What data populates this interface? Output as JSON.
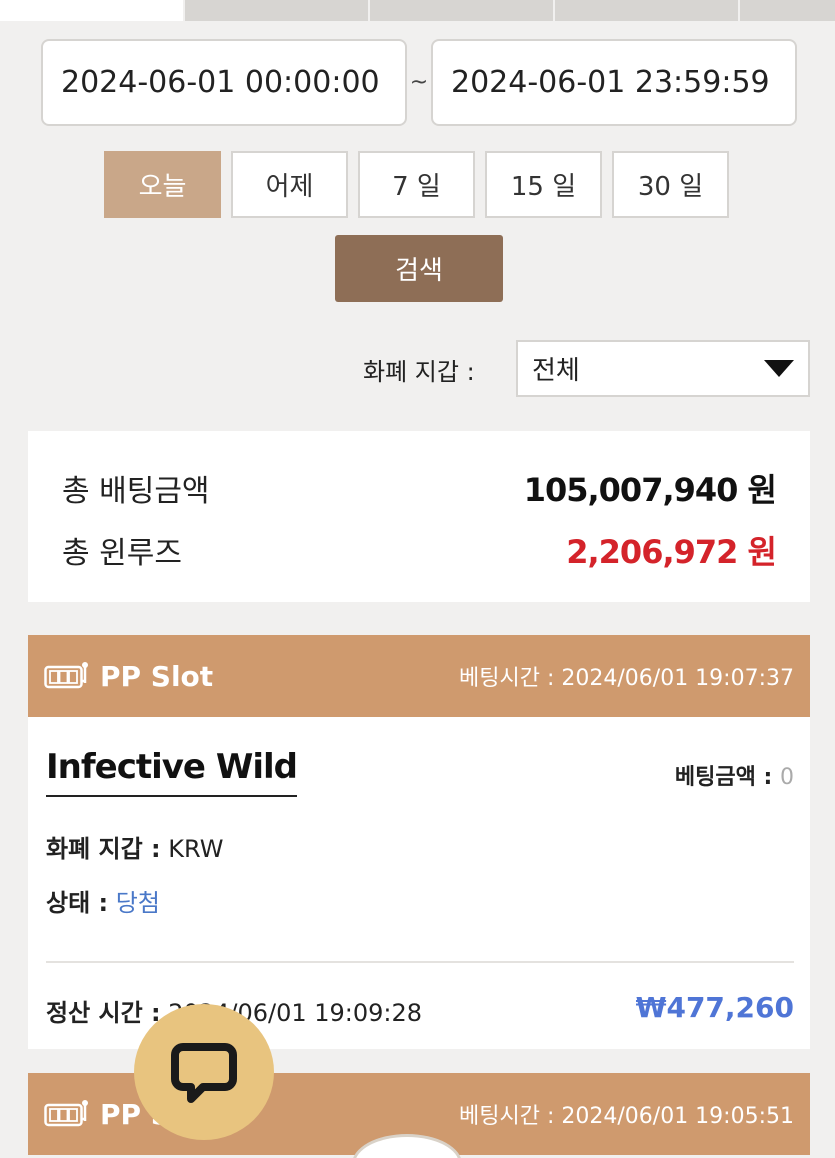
{
  "top_tabs": [
    "",
    "",
    "",
    "",
    ""
  ],
  "date_range": {
    "start": "2024-06-01 00:00:00",
    "separator": "~",
    "end": "2024-06-01 23:59:59"
  },
  "quick_filters": [
    "오늘",
    "어제",
    "7 일",
    "15 일",
    "30 일"
  ],
  "search_label": "검색",
  "wallet_filter": {
    "label": "화폐 지갑 :",
    "selected": "전체"
  },
  "summary": {
    "total_bet_label": "총 배팅금액",
    "total_bet_value": "105,007,940 원",
    "total_winloss_label": "총 윈루즈",
    "total_winloss_value": "2,206,972 원"
  },
  "bets": [
    {
      "provider": "PP Slot",
      "bet_time": "베팅시간 : 2024/06/01 19:07:37",
      "game": "Infective Wild",
      "bet_amount_label": "베팅금액 :",
      "bet_amount_value": "0",
      "wallet_label": "화폐 지갑 :",
      "wallet_value": "KRW",
      "status_label": "상태 :",
      "status_value": "당첨",
      "settle_label": "정산 시간 :",
      "settle_value": "2024/06/01 19:09:28",
      "payout": "₩477,260"
    },
    {
      "provider": "PP Slot",
      "bet_time": "베팅시간 : 2024/06/01 19:05:51"
    }
  ],
  "colors": {
    "accent": "#cf9a6e",
    "active_filter": "#c9a789",
    "search": "#8e6e56",
    "negative": "#d4232a",
    "win": "#4a78c8",
    "chat": "#e8c47f"
  }
}
